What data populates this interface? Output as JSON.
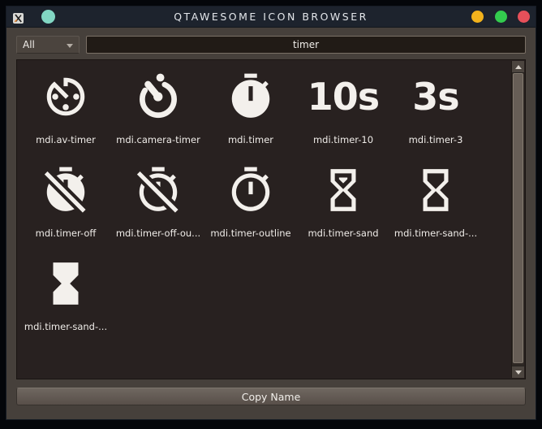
{
  "window": {
    "title": "QTAWESOME ICON BROWSER",
    "app_icon": "xterm-x-icon",
    "controls": {
      "left_circle_color": "#82d7c3",
      "minimize_color": "#f2b21c",
      "maximize_color": "#33cc4e",
      "close_color": "#e6505a"
    }
  },
  "toolbar": {
    "filter_selected": "All",
    "search_value": "timer"
  },
  "icon_grid": {
    "items": [
      {
        "label": "mdi.av-timer",
        "icon": "av-timer-icon"
      },
      {
        "label": "mdi.camera-timer",
        "icon": "camera-timer-icon"
      },
      {
        "label": "mdi.timer",
        "icon": "timer-icon"
      },
      {
        "label": "mdi.timer-10",
        "icon": "timer-10-icon",
        "glyph_text": "10s"
      },
      {
        "label": "mdi.timer-3",
        "icon": "timer-3-icon",
        "glyph_text": "3s"
      },
      {
        "label": "mdi.timer-off",
        "icon": "timer-off-icon"
      },
      {
        "label": "mdi.timer-off-ou...",
        "icon": "timer-off-outline-icon"
      },
      {
        "label": "mdi.timer-outline",
        "icon": "timer-outline-icon"
      },
      {
        "label": "mdi.timer-sand",
        "icon": "timer-sand-icon"
      },
      {
        "label": "mdi.timer-sand-...",
        "icon": "timer-sand-empty-icon"
      },
      {
        "label": "mdi.timer-sand-...",
        "icon": "timer-sand-full-icon"
      }
    ]
  },
  "footer": {
    "copy_button": "Copy Name"
  },
  "colors": {
    "titlebar": "#1d232d",
    "window_frame": "#46403b",
    "content_bg": "#282120",
    "icon_color": "#f3f0ec",
    "input_bg": "#211b16",
    "button_gradient_top": "#6f6760",
    "button_gradient_bottom": "#584f49"
  }
}
